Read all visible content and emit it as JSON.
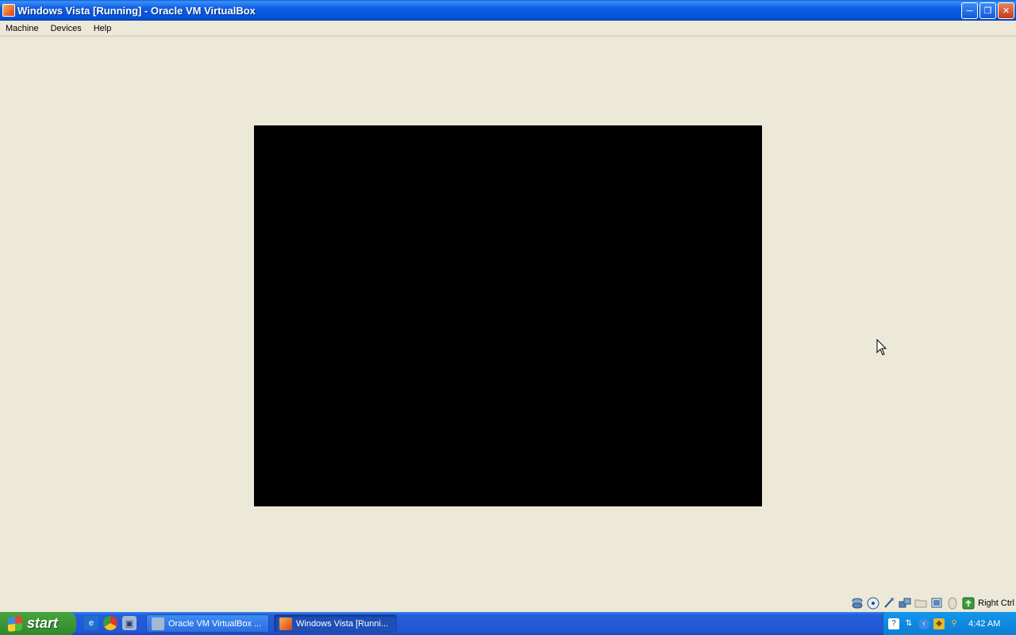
{
  "window": {
    "title": "Windows Vista [Running] - Oracle VM VirtualBox",
    "buttons": [
      "minimize",
      "restore",
      "close"
    ]
  },
  "menu": {
    "items": [
      {
        "label": "Machine"
      },
      {
        "label": "Devices"
      },
      {
        "label": "Help"
      }
    ]
  },
  "vm": {
    "screen_color": "#000000"
  },
  "statusbar": {
    "icons": [
      "hard-disk-icon",
      "optical-drive-icon",
      "usb-icon",
      "network-icon",
      "shared-folder-icon",
      "display-icon",
      "mouse-integration-icon",
      "host-key-icon"
    ],
    "host_key": "Right Ctrl"
  },
  "taskbar": {
    "start_label": "start",
    "quicklaunch": [
      "ie-icon",
      "chrome-icon",
      "virtualbox-icon"
    ],
    "tasks": [
      {
        "label": "Oracle VM VirtualBox ..."
      },
      {
        "label": "Windows Vista [Runni..."
      }
    ],
    "tray_icons": [
      "help-icon",
      "network-tray-icon",
      "back-icon",
      "security-icon",
      "search-icon"
    ],
    "clock": "4:42 AM"
  }
}
